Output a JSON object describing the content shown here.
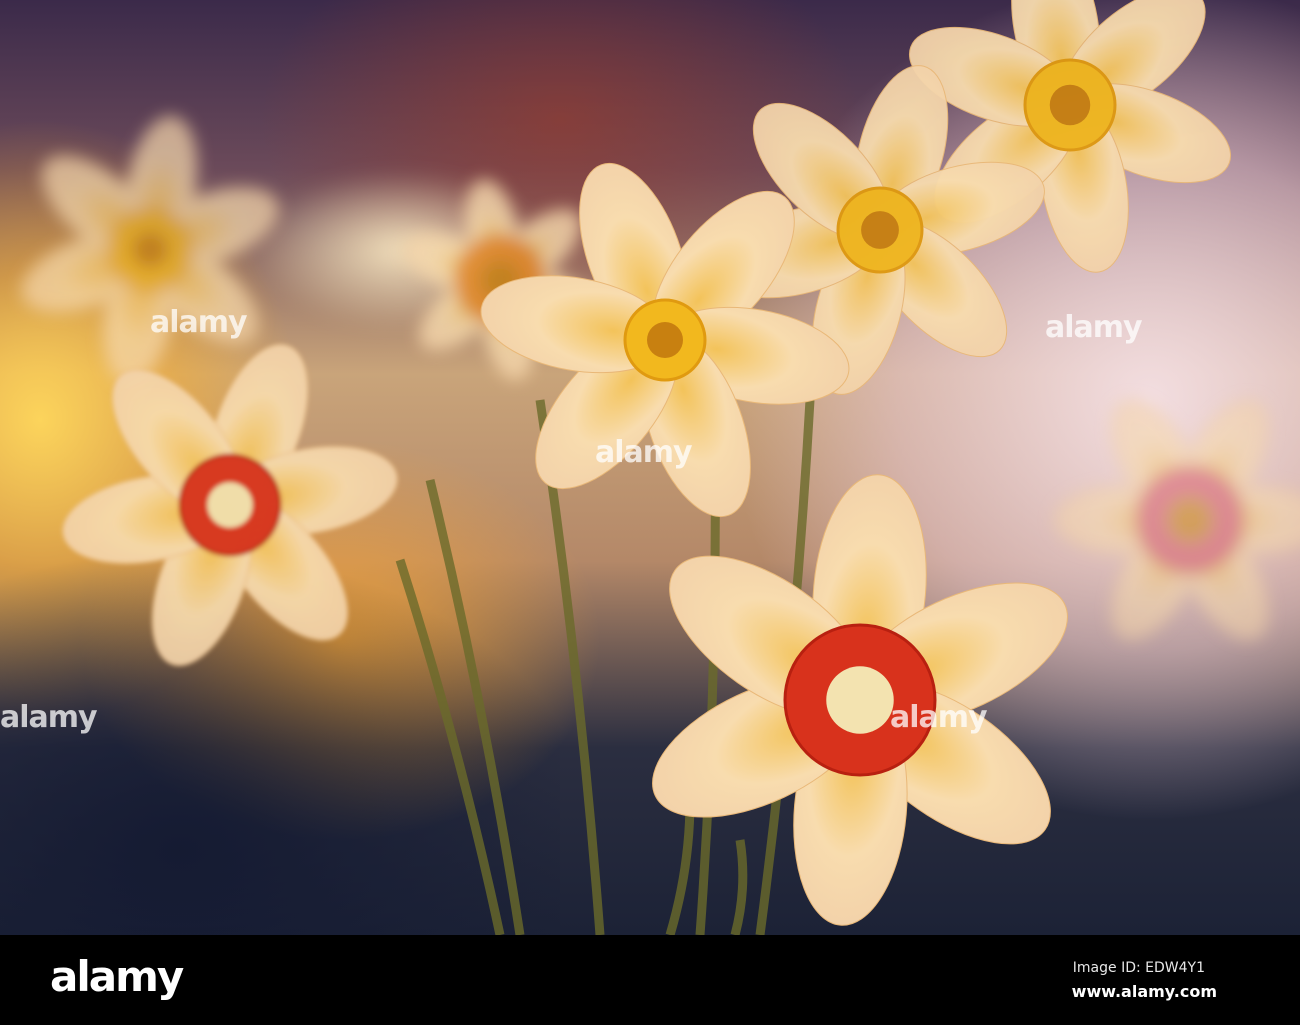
{
  "photo": {
    "subject": "daffodils",
    "watermark_text": "alamy"
  },
  "footer": {
    "logo": "alamy",
    "image_id": "Image ID: EDW4Y1",
    "url": "www.alamy.com"
  },
  "colors": {
    "petal": "#f6d9a8",
    "corona_yellow": "#f2b81e",
    "corona_red": "#d8321c",
    "stem": "#6a6a2a"
  }
}
